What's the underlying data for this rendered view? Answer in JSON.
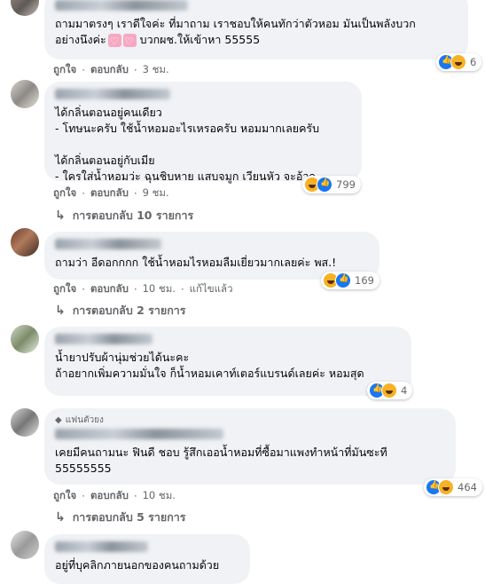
{
  "comments": [
    {
      "lines": "ถามมาตรงๆ เราดีใจค่ะ ที่มาถาม เราชอบให้คนทักว่าตัวหอม มันเป็นพลังบวก\nอย่างนึงค่ะ",
      "line_tail": " บวกผช.ให้เข้าหา 55555",
      "like": "ถูกใจ",
      "reply": "ตอบกลับ",
      "time": "3 ชม.",
      "count": "6"
    },
    {
      "lines": "ได้กลิ่นตอนอยู่คนเดียว\n- โทษนะครับ ใช้น้ำหอมอะไรเหรอครับ หอมมากเลยครับ\n\nได้กลิ่นตอนอยู่กับเมีย\n- ใครใส่น้ำหอมว่ะ ฉุนชิบหาย แสบจมูก เวียนหัว จะอ้วก",
      "like": "ถูกใจ",
      "reply": "ตอบกลับ",
      "time": "9 ชม.",
      "count": "799",
      "replies": "การตอบกลับ 10 รายการ"
    },
    {
      "lines": "ถามว่า อีดอกกกก ใช้น้ำหอมไรหอมลืมเยี่ยวมากเลยค่ะ พส.!",
      "like": "ถูกใจ",
      "reply": "ตอบกลับ",
      "time": "10 ชม.",
      "edited": "แก้ไขแล้ว",
      "count": "169",
      "replies": "การตอบกลับ 2 รายการ"
    },
    {
      "lines": "น้ำยาปรับผ้านุ่มช่วยได้นะคะ\nถ้าอยากเพิ่มความมั่นใจ ก็น้ำหอมเคาท์เตอร์แบรนด์เลยค่ะ หอมสุด",
      "count": "4"
    },
    {
      "badge": "แฟนตัวยง",
      "lines": "เคยมีคนถามนะ ฟินดี ชอบ รู้สึกเออน้ำหอมที่ซื้อมาแพงทำหน้าที่มันซะที\n55555555",
      "like": "ถูกใจ",
      "reply": "ตอบกลับ",
      "time": "10 ชม.",
      "count": "464",
      "replies": "การตอบกลับ 5 รายการ"
    },
    {
      "lines": "อยู่ที่บุคลิกภายนอกของคนถามด้วย"
    }
  ],
  "dot": "·"
}
